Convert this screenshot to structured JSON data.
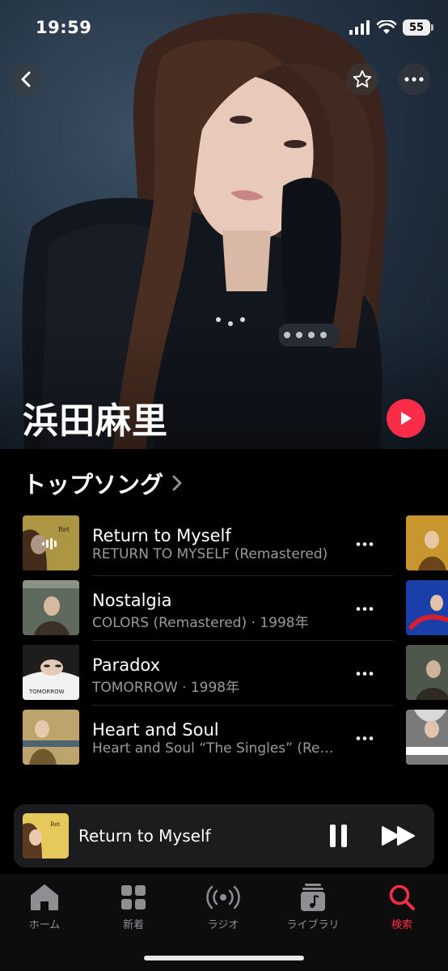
{
  "status_bar": {
    "time": "19:59",
    "battery": "55"
  },
  "artist": {
    "name": "浜田麻里"
  },
  "top_songs": {
    "title": "トップソング",
    "songs": [
      {
        "title": "Return to Myself",
        "subtitle": "RETURN TO MYSELF (Remastered)",
        "now_playing": true
      },
      {
        "title": "Nostalgia",
        "subtitle": "COLORS (Remastered) · 1998年",
        "now_playing": false
      },
      {
        "title": "Paradox",
        "subtitle": "TOMORROW · 1998年",
        "now_playing": false
      },
      {
        "title": "Heart and Soul",
        "subtitle": "Heart and Soul “The Singles” (Remastered)",
        "now_playing": false
      }
    ]
  },
  "mini_player": {
    "title": "Return to Myself"
  },
  "tabs": [
    {
      "label": "ホーム",
      "icon": "home-icon",
      "active": false
    },
    {
      "label": "新着",
      "icon": "grid-icon",
      "active": false
    },
    {
      "label": "ラジオ",
      "icon": "radio-icon",
      "active": false
    },
    {
      "label": "ライブラリ",
      "icon": "library-icon",
      "active": false
    },
    {
      "label": "検索",
      "icon": "search-icon",
      "active": true
    }
  ],
  "colors": {
    "accent": "#fa2d48",
    "background": "#000000",
    "secondary_text": "#9a9a9a"
  }
}
